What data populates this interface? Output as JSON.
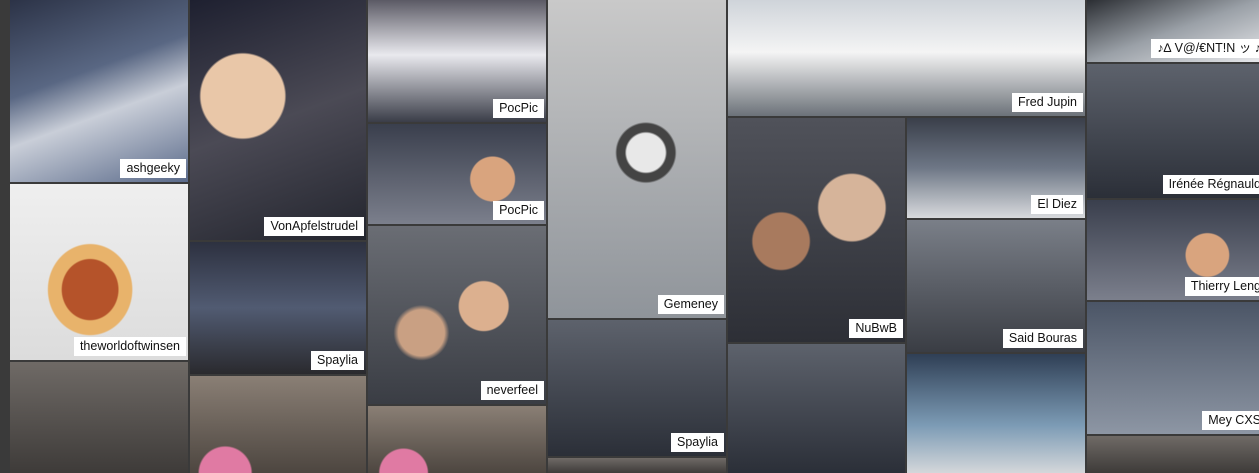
{
  "captions": {
    "ashgeeky": "ashgeeky",
    "vonapfelstrudel": "VonApfelstrudel",
    "pocpic1": "PocPic",
    "pocpic2": "PocPic",
    "fredjupin": "Fred Jupin",
    "valentin": "♪∆ V@/€NT!N ッ ♪",
    "theworldoftwinsen": "theworldoftwinsen",
    "spaylia1": "Spaylia",
    "gemeney": "Gemeney",
    "nubwb": "NuBwB",
    "eldiez": "El Diez",
    "irenee": "Irénée Régnauld",
    "thierry": "Thierry Leng",
    "neverfeel": "neverfeel",
    "saidbouras": "Said Bouras",
    "spaylia2": "Spaylia",
    "mey": "Mey CXS"
  }
}
